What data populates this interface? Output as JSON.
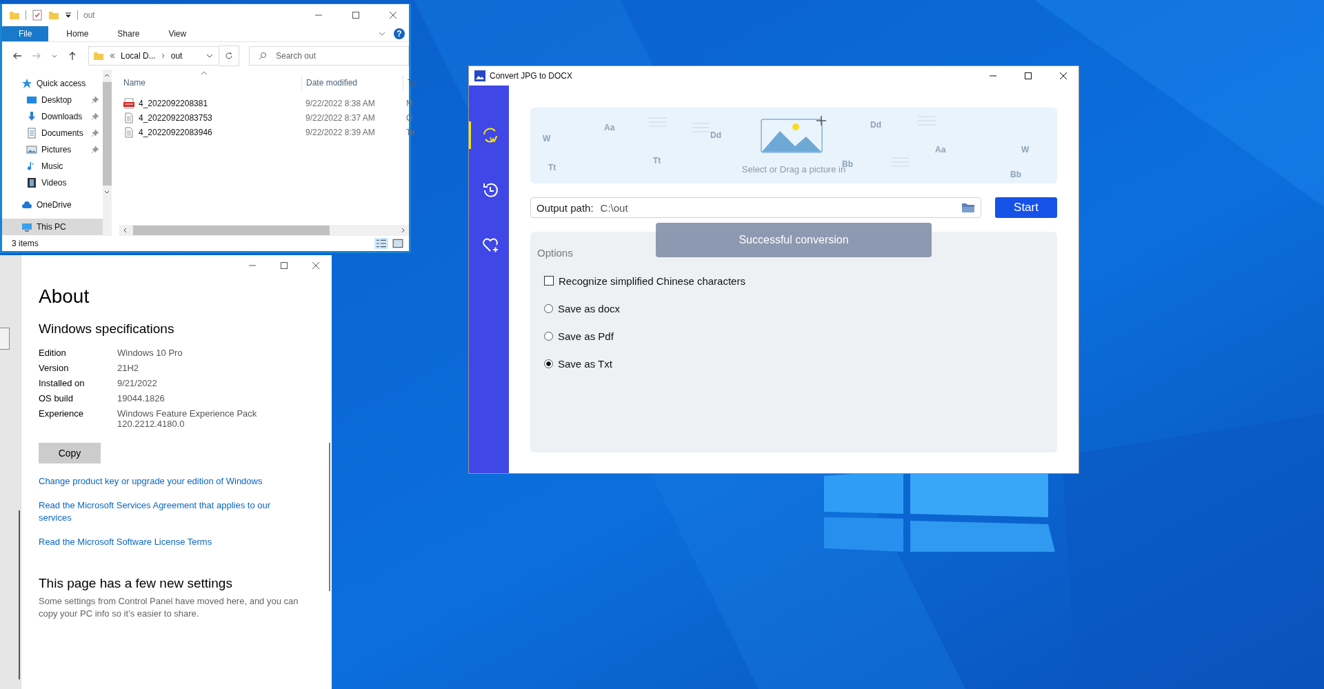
{
  "explorer": {
    "title": "out",
    "ribbon_tabs": [
      {
        "label": "File",
        "selected": true
      },
      {
        "label": "Home",
        "selected": false
      },
      {
        "label": "Share",
        "selected": false
      },
      {
        "label": "View",
        "selected": false
      }
    ],
    "help": "?",
    "breadcrumb": [
      "Local D...",
      "out"
    ],
    "search": {
      "placeholder": "Search out"
    },
    "nav": [
      {
        "label": "Quick access",
        "selected": false,
        "children": [
          {
            "label": "Desktop",
            "pinned": true,
            "selected": false
          },
          {
            "label": "Downloads",
            "pinned": true,
            "selected": false
          },
          {
            "label": "Documents",
            "pinned": true,
            "selected": false
          },
          {
            "label": "Pictures",
            "pinned": true,
            "selected": false
          },
          {
            "label": "Music",
            "pinned": false,
            "selected": false
          },
          {
            "label": "Videos",
            "pinned": false,
            "selected": false
          }
        ]
      },
      {
        "label": "OneDrive",
        "selected": false
      },
      {
        "label": "This PC",
        "selected": true
      }
    ],
    "columns": [
      "Name",
      "Date modified",
      "Ty"
    ],
    "files": [
      {
        "kind": "pdf",
        "name": "4_2022092208381",
        "date": "9/22/2022 8:38 AM",
        "type": "M"
      },
      {
        "kind": "text",
        "name": "4_20220922083753",
        "date": "9/22/2022 8:37 AM",
        "type": "O"
      },
      {
        "kind": "text",
        "name": "4_20220922083946",
        "date": "9/22/2022 8:39 AM",
        "type": "Te"
      }
    ],
    "status": "3 items"
  },
  "about": {
    "title": "About",
    "section": "Windows specifications",
    "specs": [
      {
        "label": "Edition",
        "value": "Windows 10 Pro"
      },
      {
        "label": "Version",
        "value": "21H2"
      },
      {
        "label": "Installed on",
        "value": "9/21/2022"
      },
      {
        "label": "OS build",
        "value": "19044.1826"
      },
      {
        "label": "Experience",
        "value": "Windows Feature Experience Pack 120.2212.4180.0"
      }
    ],
    "copy_button": "Copy",
    "links": [
      "Change product key or upgrade your edition of Windows",
      "Read the Microsoft Services Agreement that applies to our services",
      "Read the Microsoft Software License Terms"
    ],
    "new_settings_title": "This page has a few new settings",
    "new_settings_text": "Some settings from Control Panel have moved here, and you can copy your PC info so it’s easier to share."
  },
  "converter": {
    "title": "Convert JPG to DOCX",
    "sidebar": [
      {
        "selected": true
      },
      {
        "selected": false
      },
      {
        "selected": false
      }
    ],
    "drop_decor": [
      "W",
      "Aa",
      "Tt",
      "Tt",
      "Dd",
      "Dd",
      "Aa",
      "Bb",
      "Bb",
      "W"
    ],
    "drop_hint": "Select or Drag a picture in",
    "output_label": "Output path:",
    "output_value": "C:\\out",
    "start_button": "Start",
    "options_title": "Options",
    "options": [
      {
        "kind": "checkbox",
        "label": "Recognize simplified Chinese characters",
        "checked": false
      },
      {
        "kind": "radio",
        "label": "Save as docx",
        "selected": false
      },
      {
        "kind": "radio",
        "label": "Save as Pdf",
        "selected": false
      },
      {
        "kind": "radio",
        "label": "Save as Txt",
        "selected": true
      }
    ],
    "toast": "Successful conversion"
  }
}
